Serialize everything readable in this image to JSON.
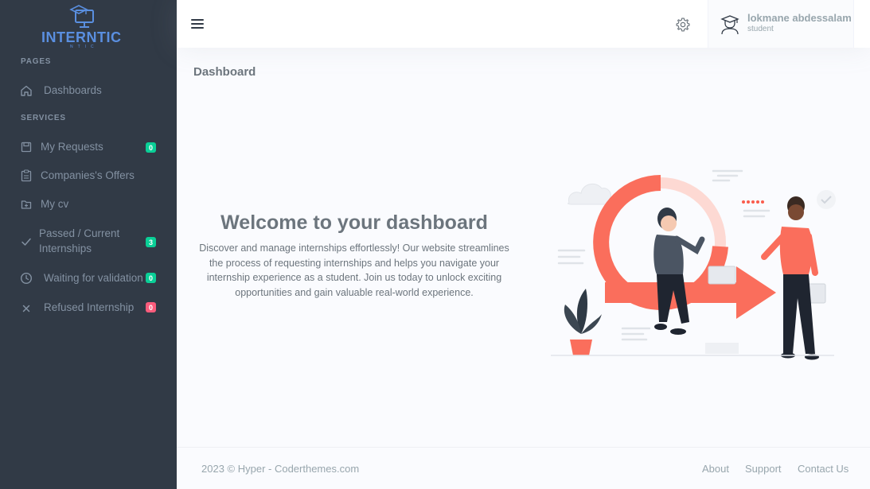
{
  "brand": {
    "name": "INTERNTIC",
    "sub": "NTIC"
  },
  "sidebar": {
    "sections": [
      {
        "title": "PAGES"
      },
      {
        "title": "SERVICES"
      }
    ],
    "items": [
      {
        "label": "Dashboards",
        "icon": "home-icon"
      },
      {
        "label": "My Requests",
        "icon": "save-icon",
        "badge": "0",
        "badge_color": "#0acf97"
      },
      {
        "label": "Companies's Offers",
        "icon": "clipboard-icon"
      },
      {
        "label": "My cv",
        "icon": "folder-plus-icon"
      },
      {
        "label": "Passed / Current",
        "label2": "Internships",
        "icon": "check-icon",
        "badge": "3",
        "badge_color": "#0acf97"
      },
      {
        "label": "Waiting for validation",
        "icon": "clock-icon",
        "badge": "0",
        "badge_color": "#0acf97"
      },
      {
        "label": "Refused Internship",
        "icon": "close-icon",
        "badge": "0",
        "badge_color": "#fa5c7c"
      }
    ]
  },
  "topbar": {
    "user_name": "lokmane abdessalam",
    "user_role": "student"
  },
  "main": {
    "page_title": "Dashboard",
    "welcome_title": "Welcome to your dashboard",
    "welcome_lines": [
      "Discover and manage internships effortlessly! Our website streamlines",
      "the process of requesting internships and helps you navigate your",
      "internship experience as a student. Join us today to unlock exciting",
      "opportunities and gain valuable real-world experience."
    ]
  },
  "footer": {
    "copyright": "2023 © Hyper - Coderthemes.com",
    "links": [
      "About",
      "Support",
      "Contact Us"
    ]
  },
  "colors": {
    "sidebar_bg": "#313a46",
    "accent": "#fa5c4c",
    "badge_green": "#0acf97",
    "badge_red": "#fa5c7c",
    "brand_blue": "#5a8fe0"
  }
}
